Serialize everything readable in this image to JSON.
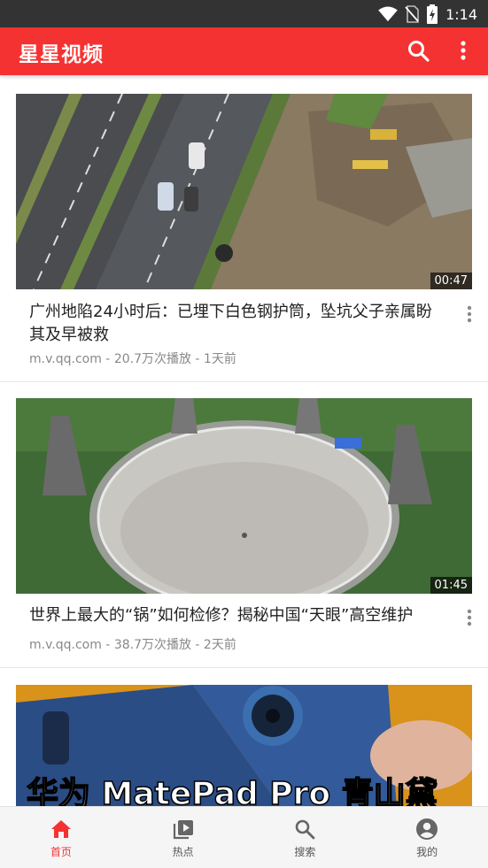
{
  "status_bar": {
    "time": "1:14"
  },
  "app_bar": {
    "title": "星星视频"
  },
  "feed": {
    "items": [
      {
        "title": "广州地陷24小时后：已埋下白色钢护筒，坠坑父子亲属盼其及早被救",
        "meta": "m.v.qq.com - 20.7万次播放 - 1天前",
        "duration": "00:47"
      },
      {
        "title": "世界上最大的“锅”如何检修？揭秘中国“天眼”高空维护",
        "meta": "m.v.qq.com - 38.7万次播放 - 2天前",
        "duration": "01:45"
      },
      {
        "overlay_text": "华为 MatePad Pro 青山黛"
      }
    ]
  },
  "bottom_nav": {
    "items": [
      {
        "label": "首页",
        "icon": "home-icon",
        "active": true
      },
      {
        "label": "热点",
        "icon": "video-library-icon",
        "active": false
      },
      {
        "label": "搜索",
        "icon": "search-icon",
        "active": false
      },
      {
        "label": "我的",
        "icon": "account-icon",
        "active": false
      }
    ]
  },
  "colors": {
    "accent": "#f53232",
    "status_bar": "#333333"
  }
}
